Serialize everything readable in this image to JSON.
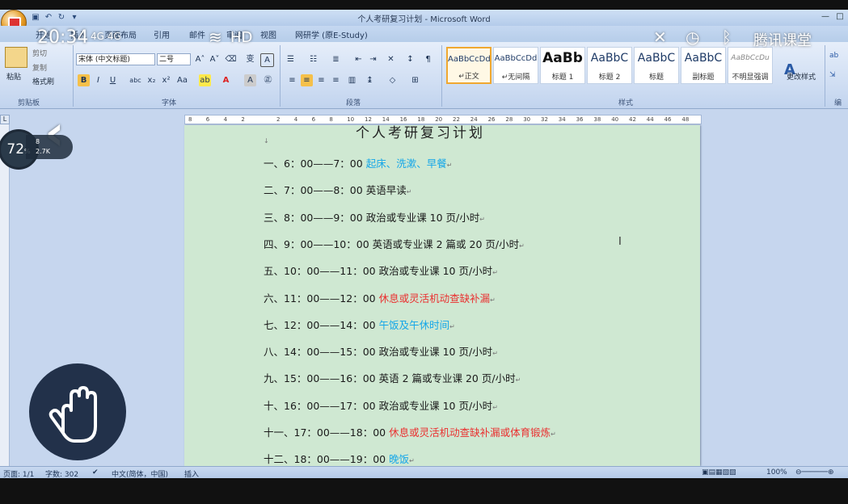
{
  "window": {
    "title": "个人考研复习计划 - Microsoft Word"
  },
  "overlay": {
    "time": "20:34",
    "signal": "4G 4G",
    "hd": "HD",
    "right_app": "腾讯课堂",
    "battery_pct": "72",
    "net_up": "8",
    "net_down": "2.7K"
  },
  "tabs": [
    "开始",
    "插入",
    "页面布局",
    "引用",
    "邮件",
    "审阅",
    "视图",
    "网研学 (原E-Study)"
  ],
  "clipboard": {
    "paste": "粘贴",
    "cut": "剪切",
    "copy": "复制",
    "format_painter": "格式刷",
    "label": "剪贴板"
  },
  "font": {
    "name": "宋体 (中文标题)",
    "size": "二号",
    "label": "字体",
    "char_a": "A",
    "wen": "变"
  },
  "paragraph": {
    "label": "段落"
  },
  "styles": {
    "label": "样式",
    "items": [
      {
        "sample": "AaBbCcDd",
        "name": "↵正文"
      },
      {
        "sample": "AaBbCcDd",
        "name": "↵无间隔"
      },
      {
        "sample": "AaBb",
        "name": "标题 1"
      },
      {
        "sample": "AaBbC",
        "name": "标题 2"
      },
      {
        "sample": "AaBbC",
        "name": "标题"
      },
      {
        "sample": "AaBbC",
        "name": "副标题"
      },
      {
        "sample": "AaBbCcDu",
        "name": "不明显强调"
      }
    ],
    "change": "更改样式"
  },
  "edit_label": "编",
  "ruler": [
    "8",
    "6",
    "4",
    "2",
    "",
    "2",
    "4",
    "6",
    "8",
    "10",
    "12",
    "14",
    "16",
    "18",
    "20",
    "22",
    "24",
    "26",
    "28",
    "30",
    "32",
    "34",
    "36",
    "38",
    "40",
    "42",
    "44",
    "46",
    "48"
  ],
  "document": {
    "lines": [
      {
        "prefix": "一、6：00——7：00 ",
        "text": "起床、洗漱、早餐",
        "color": "blue"
      },
      {
        "prefix": "二、7：00——8：00 ",
        "text": "英语早读",
        "color": "black"
      },
      {
        "prefix": "三、8：00——9：00 ",
        "text": "政治或专业课 10 页/小时",
        "color": "black"
      },
      {
        "prefix": "四、9：00——10：00 ",
        "text": "英语或专业课 2 篇或 20 页/小时",
        "color": "black"
      },
      {
        "prefix": "五、10：00——11：00 ",
        "text": "政治或专业课 10 页/小时",
        "color": "black"
      },
      {
        "prefix": "六、11：00——12：00 ",
        "text": "休息或灵活机动查缺补漏",
        "color": "red"
      },
      {
        "prefix": "七、12：00——14：00 ",
        "text": "午饭及午休时间",
        "color": "blue"
      },
      {
        "prefix": "八、14：00——15：00 ",
        "text": "政治或专业课 10 页/小时",
        "color": "black"
      },
      {
        "prefix": "九、15：00——16：00 ",
        "text": "英语 2 篇或专业课 20 页/小时",
        "color": "black"
      },
      {
        "prefix": "十、16：00——17：00 ",
        "text": "政治或专业课 10 页/小时",
        "color": "black"
      },
      {
        "prefix": "十一、17：00——18：00 ",
        "text": "休息或灵活机动查缺补漏或体育锻炼",
        "color": "red"
      },
      {
        "prefix": "十二、18：00——19：00 ",
        "text": "晚饭",
        "color": "blue"
      }
    ]
  },
  "status": {
    "page": "页面: 1/1",
    "words": "字数: 302",
    "lang": "中文(简体，中国)",
    "mode": "插入",
    "zoom": "100%"
  },
  "colors": {
    "blue": "#16a7e8",
    "red": "#ea3030",
    "page_bg": "#cfe8d2"
  }
}
